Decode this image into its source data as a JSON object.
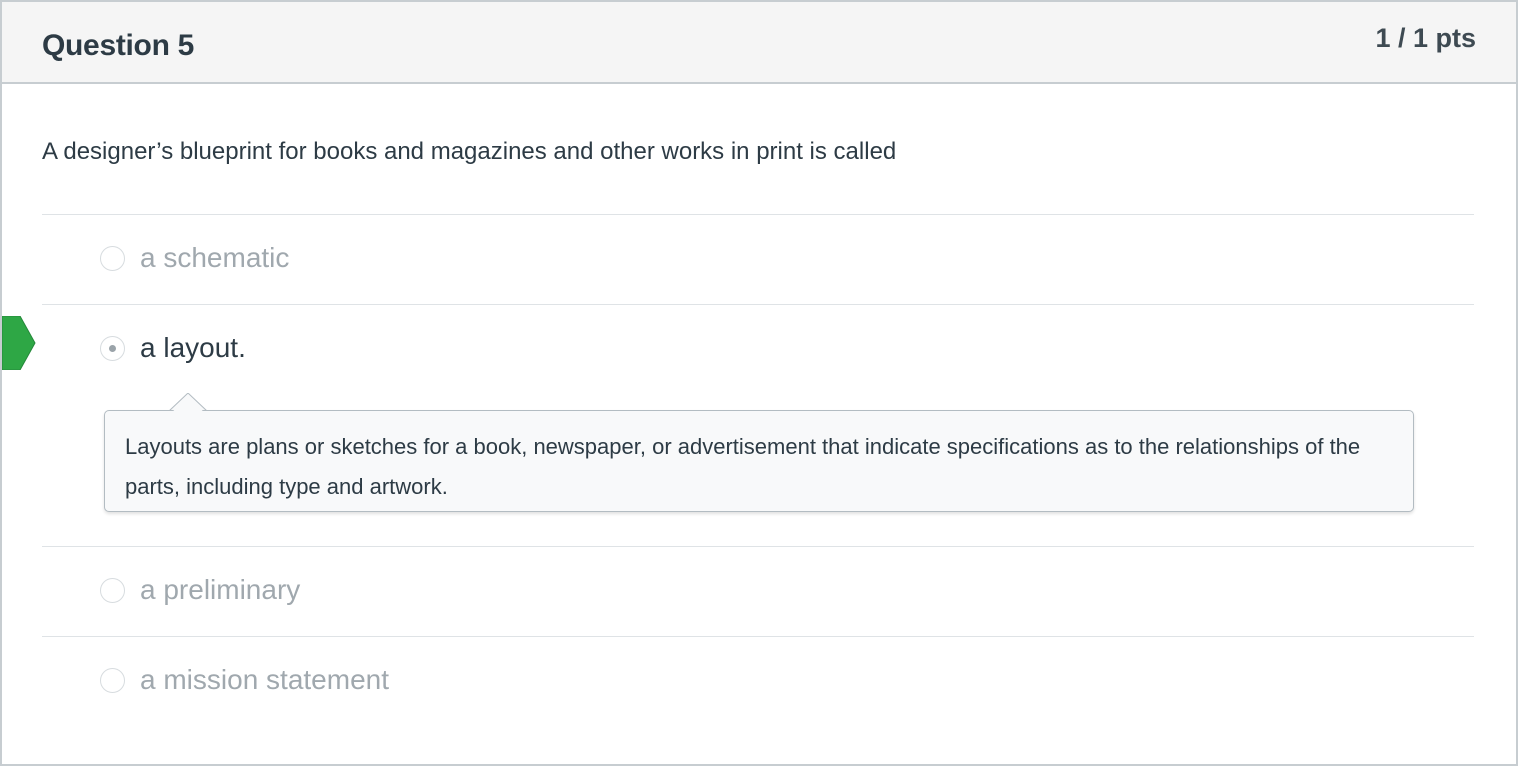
{
  "question": {
    "title": "Question 5",
    "points": "1 / 1 pts",
    "text": "A designer’s blueprint for books and magazines and other works in print is called"
  },
  "answers": [
    {
      "label": "a schematic",
      "selected": false
    },
    {
      "label": "a layout.",
      "selected": true
    },
    {
      "label": "a preliminary",
      "selected": false
    },
    {
      "label": "a mission statement",
      "selected": false
    }
  ],
  "feedback": {
    "text": "Layouts are plans or sketches for a book, newspaper, or advertisement that indicate specifications as to the relationships of the parts, including type and artwork."
  },
  "colors": {
    "correct_marker": "#2ea745",
    "header_bg": "#f5f5f5",
    "border": "#c7cdd1"
  },
  "icons": {
    "correct_marker": "correct-answer-arrow-icon"
  }
}
